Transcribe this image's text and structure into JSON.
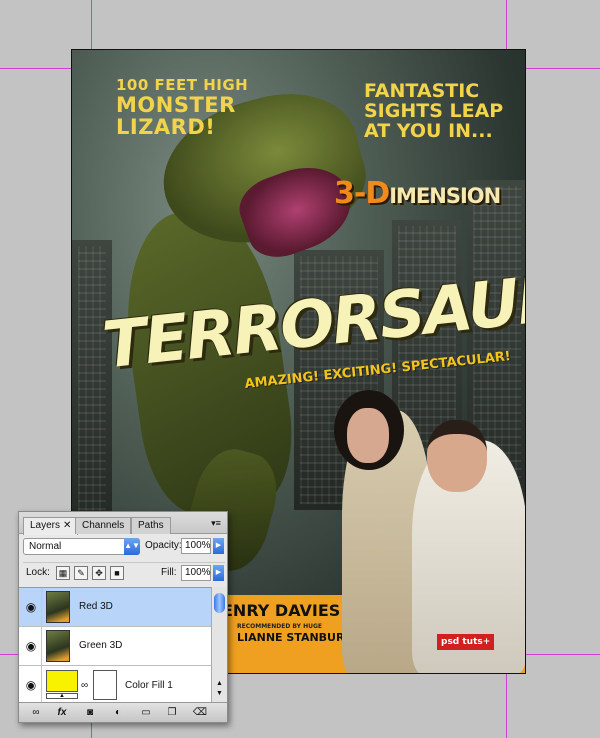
{
  "poster": {
    "top_left_line1": "100 FEET HIGH",
    "top_left_line2": "MONSTER",
    "top_left_line3": "LIZARD!",
    "top_right_line1": "FANTASTIC",
    "top_right_line2": "SIGHTS LEAP",
    "top_right_line3": "AT YOU IN...",
    "dimension_lead": "3-D",
    "dimension_rest": "IMENSION",
    "title": "TERRORSAUR!",
    "tagline": "AMAZING! EXCITING! SPECTACULAR!",
    "credit_actor": "ENRY DAVIES",
    "credit_small": "RECOMMENDED BY HUGE",
    "credit_actress": "LIANNE STANBURY",
    "logo": "psd tuts+"
  },
  "layers_panel": {
    "tabs": [
      {
        "label": "Layers",
        "close": "✕"
      },
      {
        "label": "Channels"
      },
      {
        "label": "Paths"
      }
    ],
    "menu_icon": "▾≡",
    "blend_mode": "Normal",
    "opacity_label": "Opacity:",
    "opacity_value": "100%",
    "lock_label": "Lock:",
    "fill_label": "Fill:",
    "fill_value": "100%",
    "layers": [
      {
        "name": "Red 3D",
        "selected": true
      },
      {
        "name": "Green 3D",
        "selected": false
      },
      {
        "name": "Color Fill 1",
        "selected": false,
        "fill_color": "#f8f200"
      }
    ],
    "bottom_icons": [
      "link-icon",
      "fx-icon",
      "mask-icon",
      "adjustment-icon",
      "folder-icon",
      "new-layer-icon",
      "trash-icon"
    ],
    "fx_label": "fx"
  }
}
